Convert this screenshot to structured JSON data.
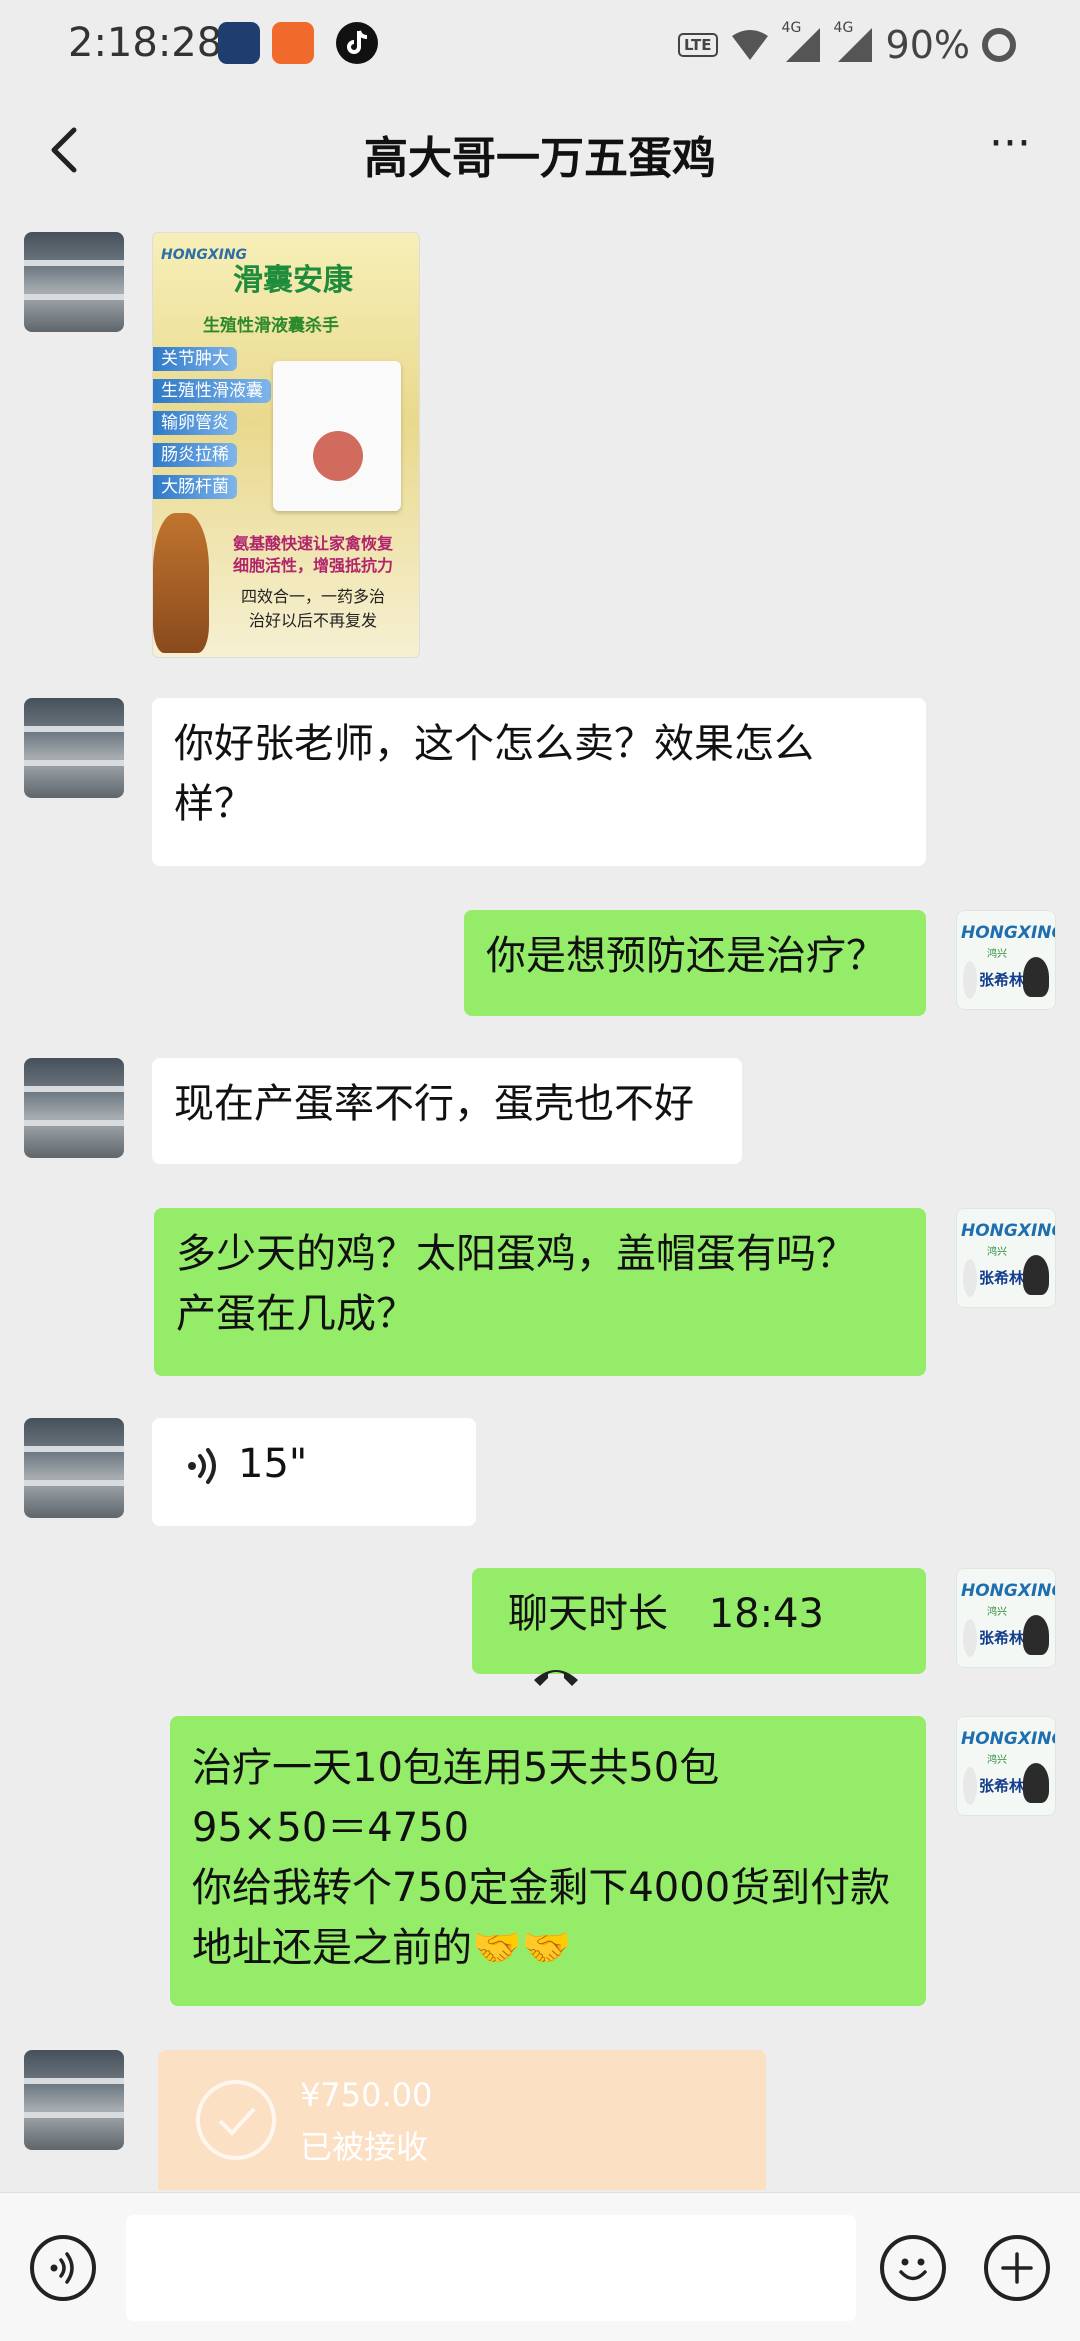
{
  "status_bar": {
    "time": "2:18:28",
    "network_badge": "LTE",
    "sig1": "4G",
    "sig2": "4G",
    "battery": "90%"
  },
  "header": {
    "title": "高大哥一万五蛋鸡",
    "more": "···"
  },
  "product_image": {
    "logo": "HONGXING",
    "headline": "滑囊安康",
    "subheadline": "生殖性滑液囊杀手",
    "tags": [
      "关节肿大",
      "生殖性滑液囊",
      "输卵管炎",
      "肠炎拉稀",
      "大肠杆菌"
    ],
    "promo_line1": "氨基酸快速让家禽恢复",
    "promo_line2": "细胞活性，增强抵抗力",
    "promo_line3": "四效合一，一药多治",
    "promo_line4": "治好以后不再复发"
  },
  "brand_avatar": {
    "logo": "HONGXING",
    "logo_cn": "鸿兴",
    "person": "张希林"
  },
  "messages": [
    {
      "side": "in",
      "lines": [
        "你好张老师，这个怎么卖？效果怎么",
        "样？"
      ]
    },
    {
      "side": "out",
      "lines": [
        "你是想预防还是治疗？"
      ]
    },
    {
      "side": "in",
      "lines": [
        "现在产蛋率不行，蛋壳也不好"
      ]
    },
    {
      "side": "out",
      "lines": [
        "多少天的鸡？太阳蛋鸡，盖帽蛋有吗？",
        "产蛋在几成？"
      ]
    },
    {
      "side": "in",
      "voice_duration": "15\""
    },
    {
      "side": "out",
      "call_label": "聊天时长",
      "call_duration": "18:43"
    },
    {
      "side": "out",
      "lines": [
        "治疗一天10包连用5天共50包",
        "95×50＝4750",
        "你给我转个750定金剩下4000货到付款",
        "地址还是之前的🤝🤝"
      ]
    }
  ],
  "transfer": {
    "amount": "¥750.00",
    "status": "已被接收"
  },
  "input_bar": {
    "placeholder": ""
  },
  "colors": {
    "background": "#ededed",
    "outgoing_bubble": "#95ec69",
    "incoming_bubble": "#ffffff",
    "transfer_card": "#fbe0c4"
  }
}
